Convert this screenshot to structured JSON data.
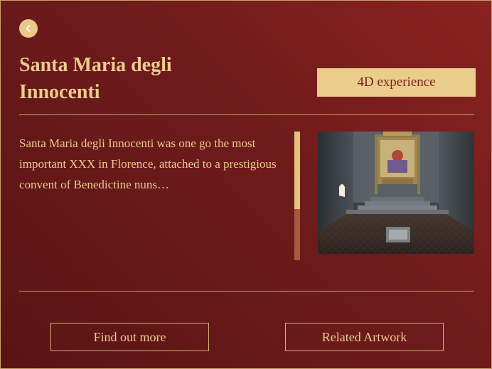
{
  "header": {
    "back_icon": "chevron-left-icon",
    "title": "Santa Maria degli Innocenti",
    "experience_label": "4D experience"
  },
  "content": {
    "description": "Santa Maria degli Innocenti was one go the most important XXX in Florence, attached to a prestigious convent of Benedictine nuns…",
    "scroll_position": 0.6,
    "image": "church-interior-altar-render"
  },
  "actions": {
    "find_out_more_label": "Find out more",
    "related_artwork_label": "Related Artwork"
  },
  "colors": {
    "accent_gold": "#ebcd8b",
    "background_red": "#7a1f1d"
  }
}
